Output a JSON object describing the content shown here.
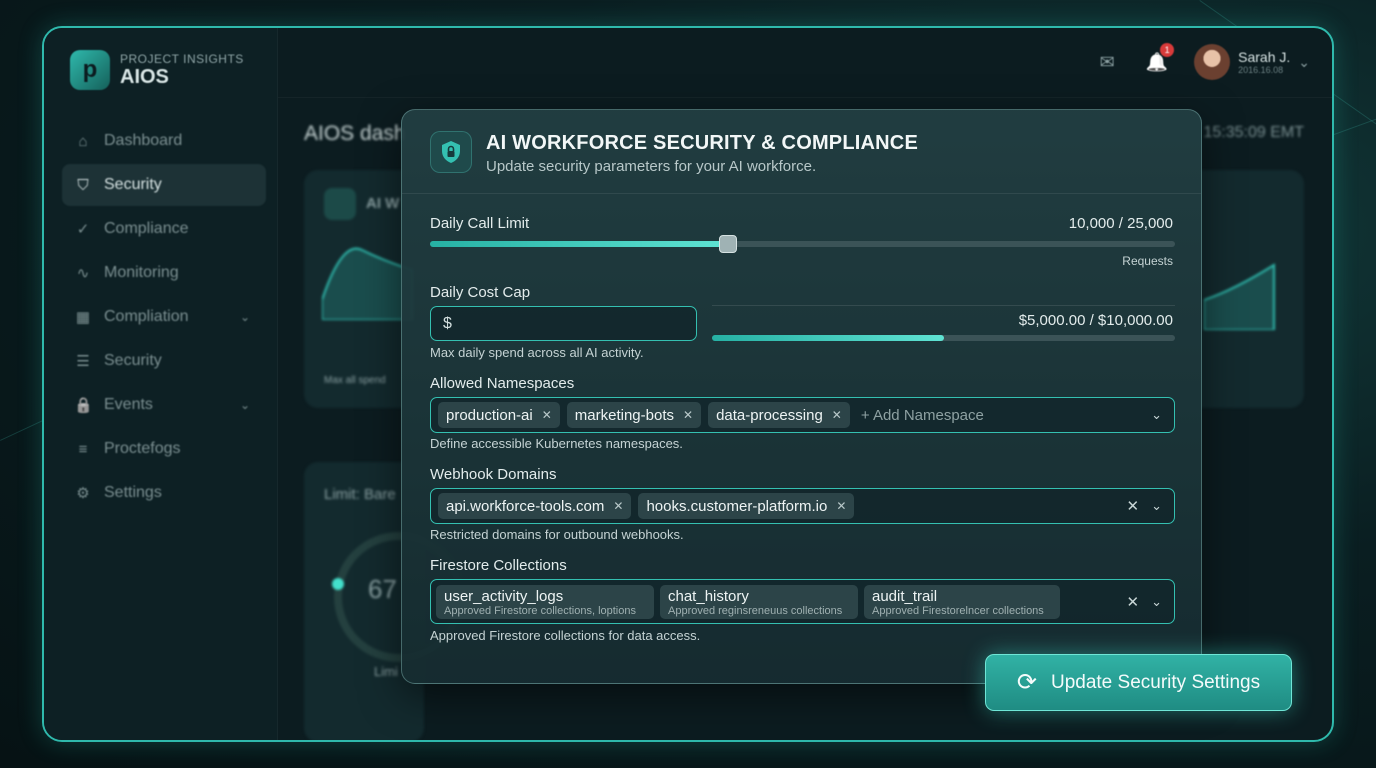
{
  "app": {
    "logo_top": "PROJECT INSIGHTS",
    "logo_main": "AIOS",
    "logo_glyph": "p"
  },
  "sidebar": {
    "items": [
      {
        "label": "Dashboard",
        "icon": "home-icon",
        "glyph": "⌂",
        "active": false
      },
      {
        "label": "Security",
        "icon": "shield-icon",
        "glyph": "⛉",
        "active": true
      },
      {
        "label": "Compliance",
        "icon": "shield-check-icon",
        "glyph": "✓",
        "active": false
      },
      {
        "label": "Monitoring",
        "icon": "pulse-icon",
        "glyph": "∿",
        "active": false
      },
      {
        "label": "Compliation",
        "icon": "grid-icon",
        "glyph": "▦",
        "active": false,
        "chevron": "⌄"
      },
      {
        "label": "Security",
        "icon": "list-icon",
        "glyph": "☰",
        "active": false
      },
      {
        "label": "Events",
        "icon": "lock-icon",
        "glyph": "🔒",
        "active": false,
        "chevron": "⌄"
      },
      {
        "label": "Proctefogs",
        "icon": "database-icon",
        "glyph": "≡",
        "active": false
      },
      {
        "label": "Settings",
        "icon": "gear-icon",
        "glyph": "⚙",
        "active": false
      }
    ]
  },
  "header": {
    "message_glyph": "✉",
    "bell_glyph": "🔔",
    "notification_count": "1",
    "user_name": "Sarah J.",
    "user_sub": "2016.16.08",
    "chevron": "⌄"
  },
  "dashboard": {
    "title": "AIOS dash",
    "time": "15:35:09 EMT",
    "card1_label": "AI W",
    "card1_hint": "Max all spend",
    "card2_label": "Limit: Bare",
    "card2_value": "67",
    "card2_caption": "Limi"
  },
  "modal": {
    "title": "AI WORKFORCE SECURITY & COMPLIANCE",
    "subtitle": "Update security parameters for your AI workforce.",
    "shield_glyph": "🔒",
    "call_limit": {
      "label": "Daily Call Limit",
      "value_text": "10,000 / 25,000",
      "unit": "Requests",
      "current": 10000,
      "max": 25000
    },
    "cost_cap": {
      "label": "Daily Cost Cap",
      "currency_symbol": "$",
      "value_text": "$5,000.00 / $10,000.00",
      "hint": "Max daily spend across all AI activity.",
      "current": 5000,
      "max": 10000
    },
    "namespaces": {
      "label": "Allowed Namespaces",
      "tags": [
        "production-ai",
        "marketing-bots",
        "data-processing"
      ],
      "placeholder": "+ Add Namespace",
      "hint": "Define accessible Kubernetes namespaces."
    },
    "webhooks": {
      "label": "Webhook Domains",
      "tags": [
        "api.workforce-tools.com",
        "hooks.customer-platform.io"
      ],
      "hint": "Restricted domains for outbound webhooks."
    },
    "firestore": {
      "label": "Firestore Collections",
      "tags": [
        {
          "name": "user_activity_logs",
          "desc": "Approved Firestore collections, loptions"
        },
        {
          "name": "chat_history",
          "desc": "Approved reginsreneuus collections"
        },
        {
          "name": "audit_trail",
          "desc": "Approved Firestorelncer collections"
        }
      ],
      "hint": "Approved Firestore collections for data access."
    },
    "tag_remove_glyph": "✕",
    "clear_glyph": "✕",
    "chevron_glyph": "⌄"
  },
  "cta": {
    "label": "Update Security Settings",
    "icon_glyph": "⟳"
  },
  "colors": {
    "accent": "#2fb9ac",
    "background": "#0c1c20",
    "badge": "#d83a3a"
  }
}
